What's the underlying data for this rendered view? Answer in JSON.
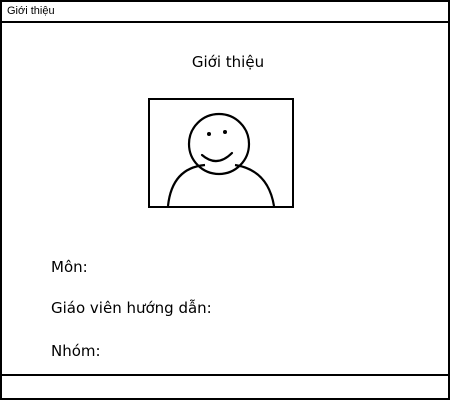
{
  "window": {
    "title": "Giới thiệu"
  },
  "main": {
    "heading": "Giới thiệu",
    "avatar_icon": "smiley-person-placeholder",
    "fields": {
      "subject_label": "Môn:",
      "teacher_label": "Giáo viên hướng dẫn:",
      "group_label": "Nhóm:"
    }
  }
}
